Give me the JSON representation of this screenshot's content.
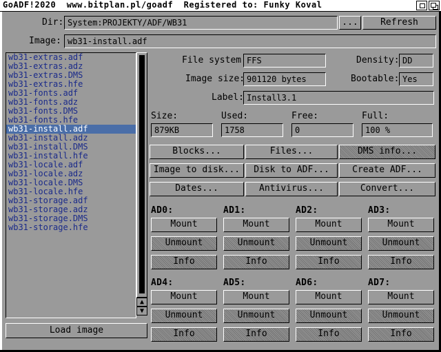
{
  "window": {
    "title": "GoADF!2020  www.bitplan.pl/goadf  Registered to: Funky Koval"
  },
  "dir": {
    "label": "Dir:",
    "value": "System:PROJEKTY/ADF/WB31",
    "browse_label": "...",
    "refresh_label": "Refresh"
  },
  "image": {
    "label": "Image:",
    "value": "wb31-install.adf"
  },
  "file_list": {
    "items": [
      "wb31-extras.adf",
      "wb31-extras.adz",
      "wb31-extras.DMS",
      "wb31-extras.hfe",
      "wb31-fonts.adf",
      "wb31-fonts.adz",
      "wb31-fonts.DMS",
      "wb31-fonts.hfe",
      "wb31-install.adf",
      "wb31-install.adz",
      "wb31-install.DMS",
      "wb31-install.hfe",
      "wb31-locale.adf",
      "wb31-locale.adz",
      "wb31-locale.DMS",
      "wb31-locale.hfe",
      "wb31-storage.adf",
      "wb31-storage.adz",
      "wb31-storage.DMS",
      "wb31-storage.hfe"
    ],
    "selected_index": 8,
    "load_label": "Load image"
  },
  "info": {
    "file_system_label": "File system:",
    "file_system": "FFS",
    "density_label": "Density:",
    "density": "DD",
    "image_size_label": "Image size:",
    "image_size": "901120 bytes",
    "bootable_label": "Bootable:",
    "bootable": "Yes",
    "label_label": "Label:",
    "label": "Install3.1",
    "size_label": "Size:",
    "size": "879KB",
    "used_label": "Used:",
    "used": "1758",
    "free_label": "Free:",
    "free": "0",
    "full_label": "Full:",
    "full": "100 %"
  },
  "actions": {
    "blocks": "Blocks...",
    "files": "Files...",
    "dms_info": "DMS info...",
    "image_to_disk": "Image to disk...",
    "disk_to_adf": "Disk to ADF...",
    "create_adf": "Create ADF...",
    "dates": "Dates...",
    "antivirus": "Antivirus...",
    "convert": "Convert..."
  },
  "drives": [
    {
      "name": "AD0:",
      "mount": "Mount",
      "unmount": "Unmount",
      "info": "Info"
    },
    {
      "name": "AD1:",
      "mount": "Mount",
      "unmount": "Unmount",
      "info": "Info"
    },
    {
      "name": "AD2:",
      "mount": "Mount",
      "unmount": "Unmount",
      "info": "Info"
    },
    {
      "name": "AD3:",
      "mount": "Mount",
      "unmount": "Unmount",
      "info": "Info"
    },
    {
      "name": "AD4:",
      "mount": "Mount",
      "unmount": "Unmount",
      "info": "Info"
    },
    {
      "name": "AD5:",
      "mount": "Mount",
      "unmount": "Unmount",
      "info": "Info"
    },
    {
      "name": "AD6:",
      "mount": "Mount",
      "unmount": "Unmount",
      "info": "Info"
    },
    {
      "name": "AD7:",
      "mount": "Mount",
      "unmount": "Unmount",
      "info": "Info"
    }
  ],
  "scroll": {
    "up_icon": "▲",
    "down_icon": "▼"
  }
}
